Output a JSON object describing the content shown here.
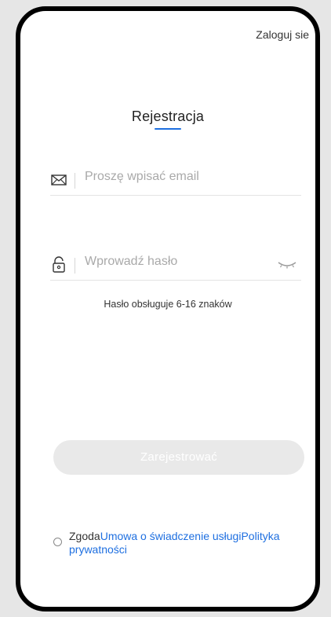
{
  "header": {
    "login_link": "Zaloguj sie"
  },
  "form": {
    "title": "Rejestracja",
    "email_placeholder": "Proszę wpisać email",
    "password_placeholder": "Wprowadź hasło",
    "password_hint": "Hasło obsługuje 6-16 znaków",
    "submit_label": "Zarejestrować"
  },
  "consent": {
    "prefix": "Zgoda",
    "terms_link": "Umowa o świadczenie usługi",
    "privacy_link": "Polityka prywatności",
    "checked": false
  },
  "colors": {
    "accent": "#1e6fe0",
    "button_disabled": "#e9e9e9"
  }
}
